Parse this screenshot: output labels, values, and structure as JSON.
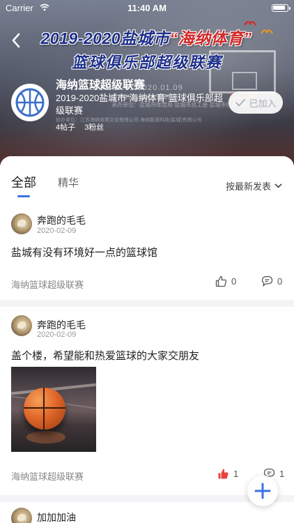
{
  "status_bar": {
    "carrier": "Carrier",
    "time": "11:40 AM"
  },
  "banner": {
    "title_pre": "2019-2020盐城市",
    "title_highlight": "“海纳体育”",
    "subtitle": "篮球俱乐部超级联赛",
    "dates": "2020.01.01-2020.01.09",
    "organizer_line1": "主办单位：盐城市篮球协会",
    "organizer_line2": "承办单位：盐城市体育局 盐城市总工会 盐城市体育总会",
    "organizer_line3": "协办单位：江苏海纳体育文化有限公司 海纳能源科技(盐城)有限公司"
  },
  "club": {
    "name": "海纳篮球超级联赛",
    "description": "2019-2020盐城市“海纳体育”篮球俱乐部超级联赛",
    "posts": "4帖子",
    "fans": "3粉丝",
    "join_label": "已加入"
  },
  "tabs": {
    "all": "全部",
    "featured": "精华",
    "sort": "按最新发表"
  },
  "posts": [
    {
      "author": "奔跑的毛毛",
      "date": "2020-02-09",
      "text": "盐城有没有环境好一点的篮球馆",
      "club": "海纳篮球超级联赛",
      "likes": "0",
      "comments": "0",
      "liked": false
    },
    {
      "author": "奔跑的毛毛",
      "date": "2020-02-09",
      "text": "盖个楼，希望能和热爱篮球的大家交朋友",
      "club": "海纳篮球超级联赛",
      "likes": "1",
      "comments": "1",
      "liked": true
    },
    {
      "author": "加加加油"
    }
  ],
  "colors": {
    "accent": "#3b72e6",
    "like_active": "#e8413c",
    "muted": "#888888"
  },
  "icons": {
    "back": "chevron-left-icon",
    "wifi": "wifi-icon",
    "battery": "battery-icon",
    "like": "thumbs-up-icon",
    "comment": "comment-icon",
    "add": "plus-icon",
    "sort": "chevron-down-icon",
    "check": "check-icon",
    "logo": "basketball-icon"
  }
}
